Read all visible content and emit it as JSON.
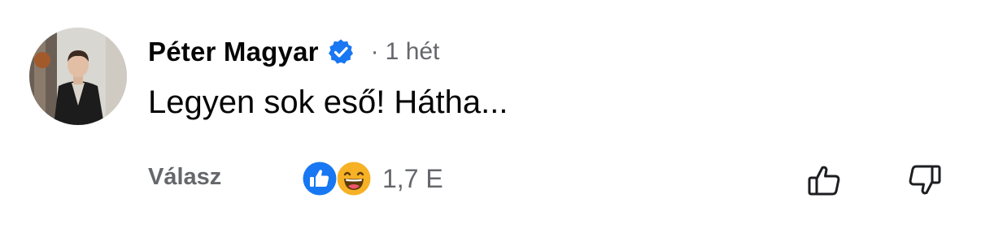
{
  "comment": {
    "author": "Péter Magyar",
    "verified": true,
    "separator": "·",
    "timestamp": "1 hét",
    "text": "Legyen sok eső! Hátha..."
  },
  "actions": {
    "reply_label": "Válasz",
    "reactions": [
      "like-icon",
      "haha-icon"
    ],
    "reaction_count": "1,7 E",
    "upvote_icon": "thumbs-up-outline-icon",
    "downvote_icon": "thumbs-down-outline-icon"
  },
  "colors": {
    "text_primary": "#050505",
    "text_secondary": "#65676b",
    "verified_blue": "#1877f2",
    "like_blue": "#1877f2",
    "haha_yellow": "#f7b125"
  }
}
